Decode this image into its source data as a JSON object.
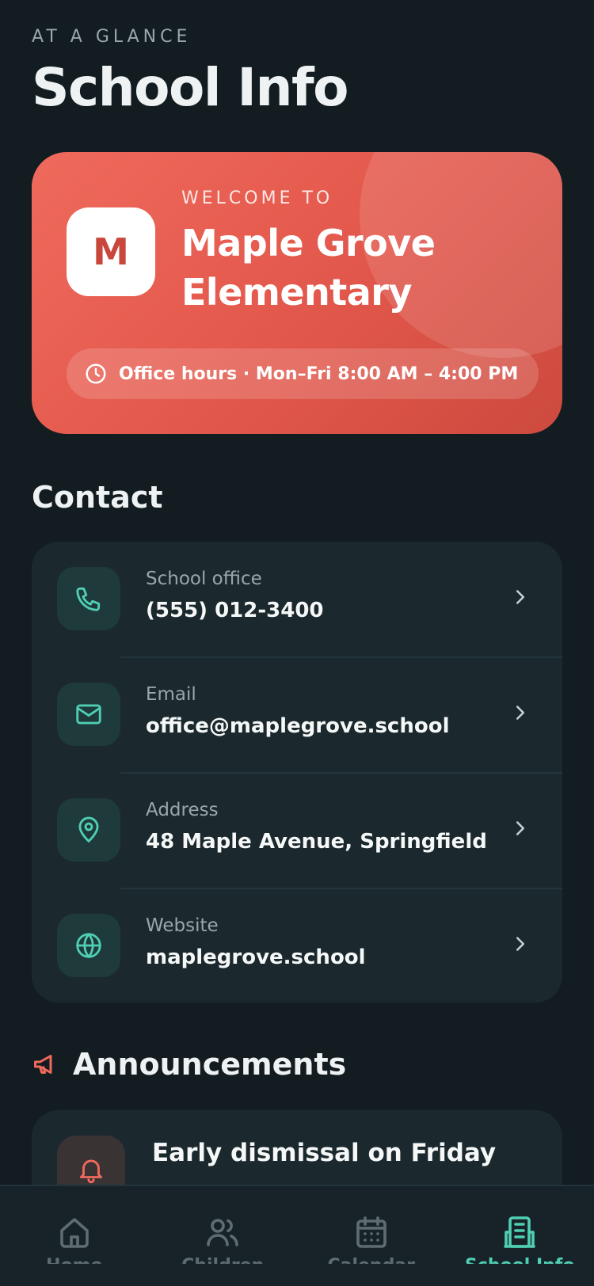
{
  "header": {
    "eyebrow": "AT A GLANCE",
    "title": "School Info"
  },
  "hero": {
    "welcome": "WELCOME TO",
    "school_name": "Maple Grove Elementary",
    "logo_letter": "M",
    "office_hours": "Office hours · Mon–Fri 8:00 AM – 4:00 PM",
    "colors": {
      "start": "#ef6a5c",
      "end": "#cd4a3e"
    }
  },
  "contact": {
    "title": "Contact",
    "items": [
      {
        "label": "School office",
        "value": "(555) 012-3400",
        "icon": "phone-icon"
      },
      {
        "label": "Email",
        "value": "office@maplegrove.school",
        "icon": "mail-icon"
      },
      {
        "label": "Address",
        "value": "48 Maple Avenue, Springfield",
        "icon": "map-pin-icon"
      },
      {
        "label": "Website",
        "value": "maplegrove.school",
        "icon": "globe-icon"
      }
    ]
  },
  "announcements": {
    "title": "Announcements",
    "icon": "megaphone-icon",
    "items": [
      {
        "title": "Early dismissal on Friday",
        "icon": "bell-icon"
      }
    ]
  },
  "tabbar": {
    "tabs": [
      {
        "label": "Home",
        "icon": "home-icon",
        "active": false
      },
      {
        "label": "Children",
        "icon": "users-icon",
        "active": false
      },
      {
        "label": "Calendar",
        "icon": "calendar-icon",
        "active": false
      },
      {
        "label": "School Info",
        "icon": "building-icon",
        "active": true
      }
    ],
    "active_color": "#4fcfb3",
    "inactive_color": "#5f6d72"
  },
  "theme": {
    "accent": "#4fcfb3",
    "background": "#121c21",
    "card": "#1b292e",
    "coral": "#ef6a5c"
  }
}
